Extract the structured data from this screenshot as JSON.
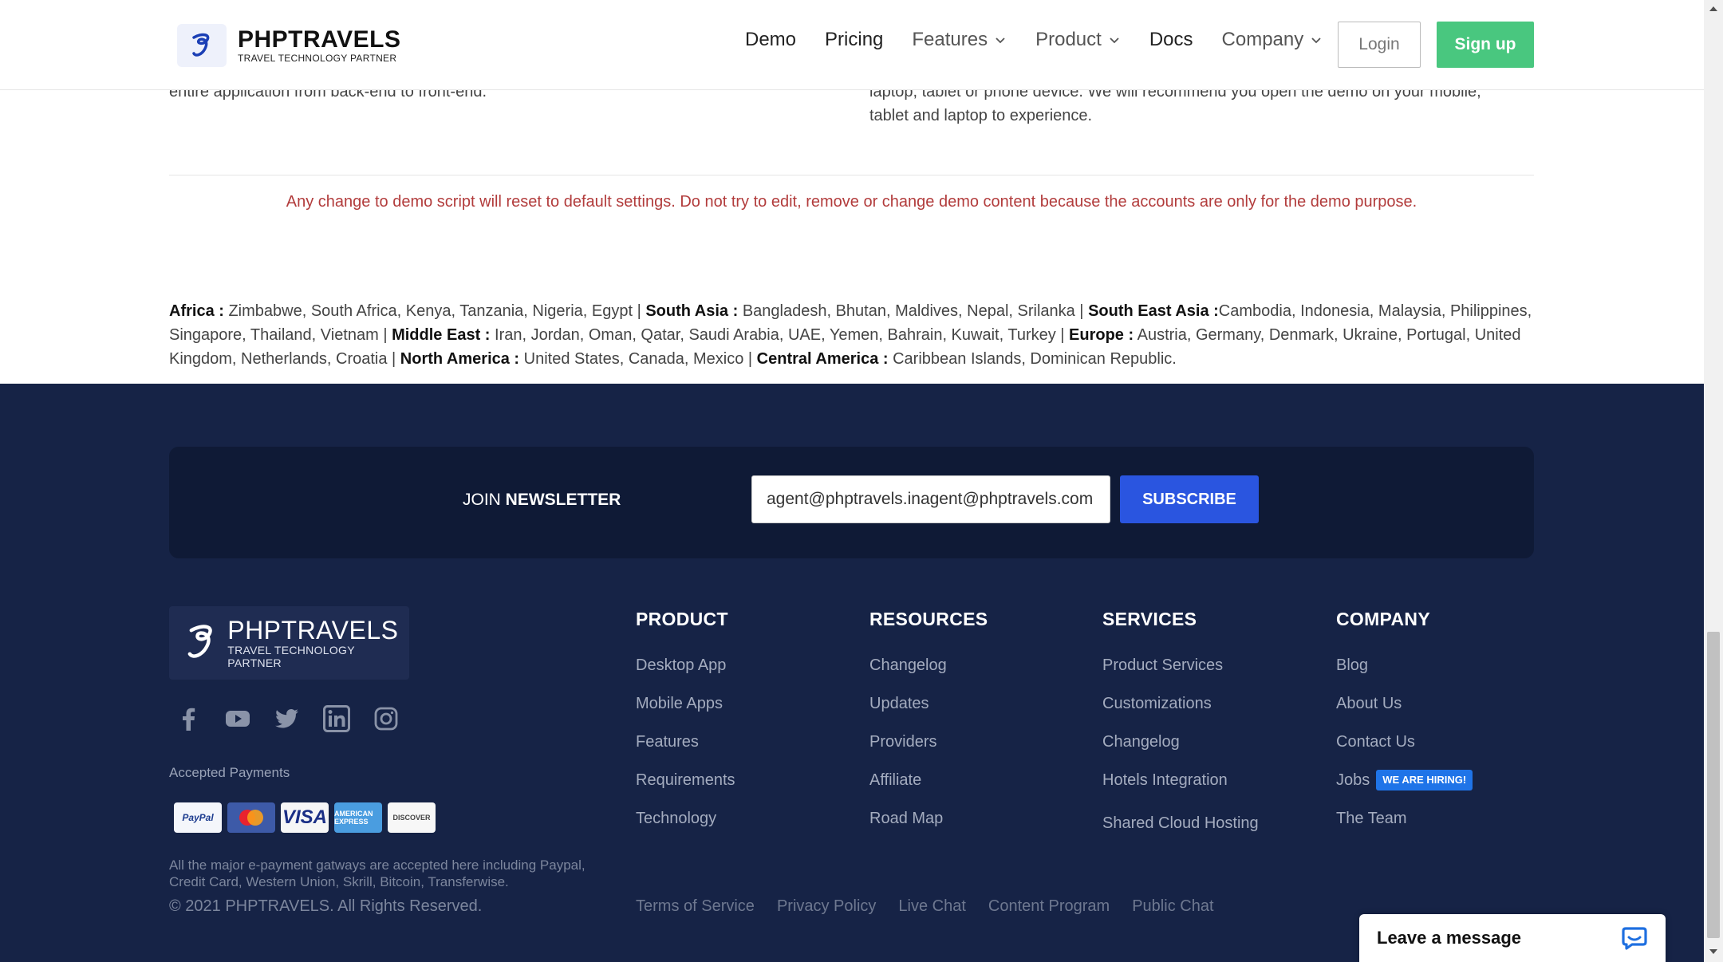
{
  "header": {
    "brand_name": "PHPTRAVELS",
    "brand_tagline": "TRAVEL TECHNOLOGY PARTNER",
    "nav": [
      {
        "label": "Demo",
        "dropdown": false
      },
      {
        "label": "Pricing",
        "dropdown": false
      },
      {
        "label": "Features",
        "dropdown": true
      },
      {
        "label": "Product",
        "dropdown": true
      },
      {
        "label": "Docs",
        "dropdown": false
      },
      {
        "label": "Company",
        "dropdown": true
      }
    ],
    "login_label": "Login",
    "signup_label": "Sign up"
  },
  "intro": {
    "left_text": "entire application from back-end to front-end.",
    "right_text": "laptop, tablet or phone device. We will recommend you open the demo on your mobile, tablet and laptop to experience."
  },
  "notice": "Any change to demo script will reset to default settings. Do not try to edit, remove or change demo content because the accounts are only for the demo purpose.",
  "regions": [
    {
      "name": "Africa :",
      "countries": " Zimbabwe, South Africa, Kenya, Tanzania, Nigeria, Egypt | "
    },
    {
      "name": "South Asia :",
      "countries": " Bangladesh, Bhutan, Maldives, Nepal, Srilanka | "
    },
    {
      "name": "South East Asia :",
      "countries": "Cambodia, Indonesia, Malaysia, Philippines, Singapore, Thailand, Vietnam | "
    },
    {
      "name": "Middle East :",
      "countries": " Iran, Jordan, Oman, Qatar, Saudi Arabia, UAE, Yemen, Bahrain, Kuwait, Turkey | "
    },
    {
      "name": "Europe :",
      "countries": " Austria, Germany, Denmark, Ukraine, Portugal, United Kingdom, Netherlands, Croatia | "
    },
    {
      "name": "North America :",
      "countries": " United States, Canada, Mexico | "
    },
    {
      "name": "Central America :",
      "countries": " Caribbean Islands, Dominican Republic."
    }
  ],
  "newsletter": {
    "label_prefix": "JOIN ",
    "label_bold": "NEWSLETTER",
    "input_value": "agent@phptravels.inagent@phptravels.com",
    "subscribe_label": "SUBSCRIBE"
  },
  "footer": {
    "brand_name": "PHPTRAVELS",
    "brand_tagline": "TRAVEL TECHNOLOGY PARTNER",
    "socials": [
      "facebook-icon",
      "youtube-icon",
      "twitter-icon",
      "linkedin-icon",
      "instagram-icon"
    ],
    "accepted_payments_label": "Accepted Payments",
    "cards": [
      {
        "name": "PayPal",
        "text": "PayPal"
      },
      {
        "name": "MasterCard",
        "text": ""
      },
      {
        "name": "Visa",
        "text": "VISA"
      },
      {
        "name": "American Express",
        "text": "AMERICAN EXPRESS"
      },
      {
        "name": "Discover",
        "text": "DISCOVER"
      }
    ],
    "payment_note": "All the major e-payment gatways are accepted here including Paypal, Credit Card, Western Union, Skrill, Bitcoin, Transferwise.",
    "copyright": "© 2021 PHPTRAVELS. All Rights Reserved.",
    "columns": [
      {
        "title": "PRODUCT",
        "links": [
          "Desktop App",
          "Mobile Apps",
          "Features",
          "Requirements",
          "Technology"
        ]
      },
      {
        "title": "RESOURCES",
        "links": [
          "Changelog",
          "Updates",
          "Providers",
          "Affiliate",
          "Road Map"
        ]
      },
      {
        "title": "SERVICES",
        "links": [
          "Product Services",
          "Customizations",
          "Changelog",
          "Hotels Integration",
          "Shared Cloud Hosting"
        ]
      },
      {
        "title": "COMPANY",
        "links": [
          "Blog",
          "About Us",
          "Contact Us",
          "Jobs",
          "The Team"
        ]
      }
    ],
    "hiring_badge": "WE ARE HIRING!",
    "bottom_links": [
      "Terms of Service",
      "Privacy Policy",
      "Live Chat",
      "Content Program",
      "Public Chat"
    ]
  },
  "chat": {
    "label": "Leave a message"
  },
  "colors": {
    "footer_bg": "#162346",
    "newsletter_bg": "#0f1a36",
    "signup_green": "#49c77f",
    "subscribe_blue": "#2a55e0",
    "notice_red": "#b23c3c",
    "hiring_blue": "#1f74e8"
  }
}
